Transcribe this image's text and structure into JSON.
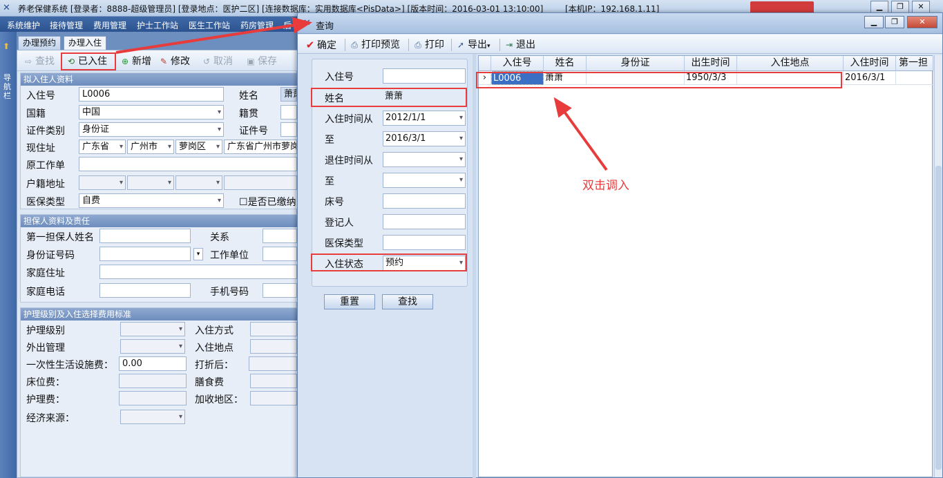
{
  "app": {
    "title_text": "养老保健系统  [登录者：8888-超级管理员] [登录地点：医护二区] [连接数据库：实用数据库<PisData>] [版本时间：2016-03-01 13:10:00]",
    "ip_text": "[本机IP：192.168.1.11]",
    "menu": [
      "系统维护",
      "接待管理",
      "费用管理",
      "护士工作站",
      "医生工作站",
      "药房管理",
      "后"
    ],
    "side_label": "导航栏"
  },
  "tabs": [
    "办理预约",
    "办理入住"
  ],
  "toolbar": {
    "find": "查找",
    "checked_in": "已入住",
    "add": "新增",
    "edit": "修改",
    "cancel": "取消",
    "save": "保存"
  },
  "section1": {
    "title": "拟入住人资料",
    "labels": [
      "入住号",
      "姓名",
      "国籍",
      "籍贯",
      "证件类别",
      "证件号",
      "现住址",
      "原工作单",
      "户籍地址",
      "医保类型",
      "是否已缴纳"
    ],
    "values": {
      "checkin_no": "L0006",
      "name_partial": "萧萧",
      "nationality": "中国",
      "id_type": "身份证",
      "province": "广东省",
      "city": "广州市",
      "district": "萝岗区",
      "address": "广东省广州市萝岗",
      "insurance": "自费"
    }
  },
  "section2": {
    "title": "担保人资料及责任",
    "labels": [
      "第一担保人姓名",
      "关系",
      "身份证号码",
      "工作单位",
      "家庭住址",
      "家庭电话",
      "手机号码"
    ]
  },
  "section3": {
    "title": "护理级别及入住选择费用标准",
    "labels": [
      "护理级别",
      "入住方式",
      "外出管理",
      "入住地点",
      "一次性生活设施费：",
      "打折后：",
      "床位费：",
      "膳食费",
      "护理费：",
      "加收地区：",
      "经济来源："
    ],
    "one_time_fee": "0.00"
  },
  "dialog": {
    "title": "查询",
    "toolbar": [
      "确定",
      "打印预览",
      "打印",
      "导出",
      "退出"
    ],
    "query": {
      "labels": [
        "入住号",
        "姓名",
        "入住时间从",
        "至",
        "退住时间从",
        "至",
        "床号",
        "登记人",
        "医保类型",
        "入住状态"
      ],
      "values": {
        "name": "萧萧",
        "checkin_from": "2012/1/1",
        "checkin_to": "2016/3/1",
        "status": "预约"
      }
    },
    "buttons": {
      "reset": "重置",
      "search": "查找"
    },
    "grid": {
      "columns": [
        "入住号",
        "姓名",
        "身份证",
        "出生时间",
        "入住地点",
        "入住时间",
        "第一担"
      ],
      "rows": [
        {
          "checkin_no": "L0006",
          "name": "萧萧",
          "id_card": "",
          "birth": "1950/3/3",
          "location": "",
          "checkin_time": "2016/3/1",
          "guarantor": ""
        }
      ]
    },
    "annotation": "双击调入"
  },
  "colors": {
    "highlight": "#e83c3c",
    "selection": "#3a6fc4"
  }
}
